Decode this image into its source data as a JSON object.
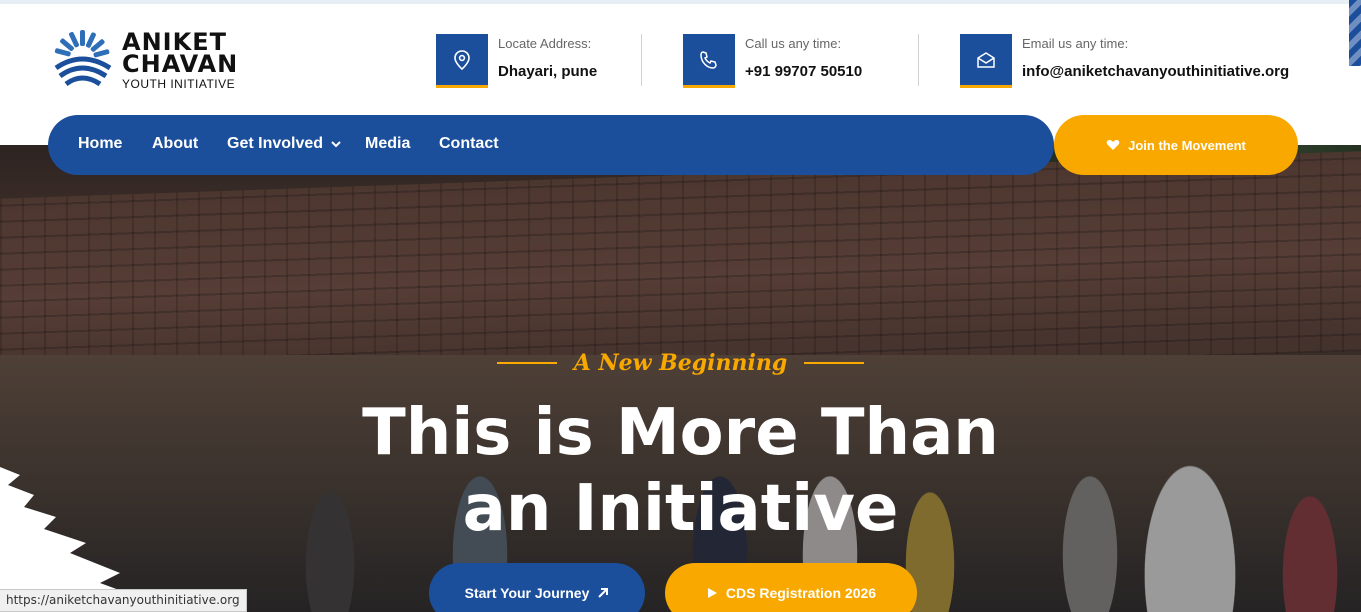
{
  "logo": {
    "line1": "ANIKET",
    "line2": "CHAVAN",
    "line3": "YOUTH INITIATIVE"
  },
  "contact": [
    {
      "label": "Locate Address:",
      "value": "Dhayari, pune",
      "icon": "location-pin-icon"
    },
    {
      "label": "Call us any time:",
      "value": "+91 99707 50510",
      "icon": "phone-icon"
    },
    {
      "label": "Email us any time:",
      "value": "info@aniketchavanyouthinitiative.org",
      "icon": "envelope-icon"
    }
  ],
  "nav": {
    "items": [
      "Home",
      "About",
      "Get Involved",
      "Media",
      "Contact"
    ],
    "join_label": "Join the Movement"
  },
  "hero": {
    "tagline": "A New Beginning",
    "headline_line1": "This is More Than",
    "headline_line2": "an Initiative",
    "btn_start": "Start Your Journey",
    "btn_cds": "CDS Registration 2026"
  },
  "status_bar": {
    "url": "https://aniketchavanyouthinitiative.org"
  },
  "colors": {
    "primary": "#1b4f9c",
    "accent": "#f9a800"
  }
}
